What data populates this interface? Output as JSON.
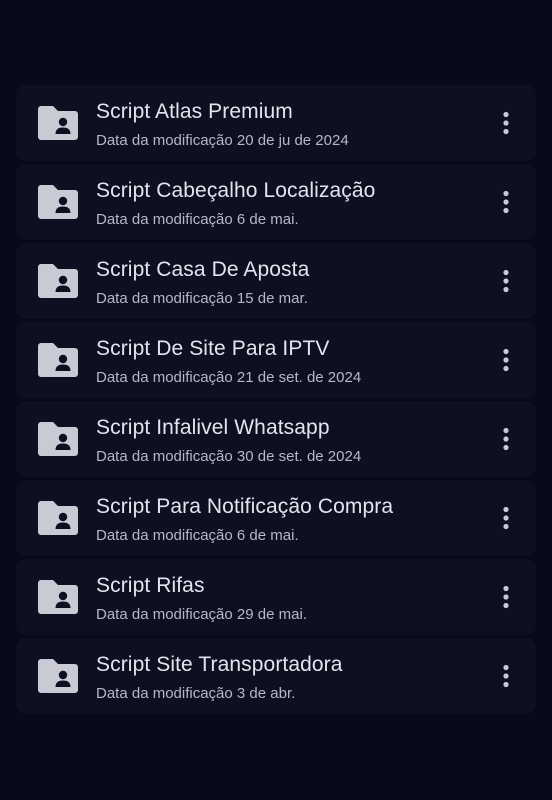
{
  "colors": {
    "background": "#080a1a",
    "card": "#0e1022",
    "title_text": "#e4e5ec",
    "meta_text": "#b6b8c4",
    "icon": "#c9cad4"
  },
  "icons": {
    "file": "shared-folder-icon",
    "menu": "more-vert-icon"
  },
  "files": [
    {
      "name": "Script Atlas Premium",
      "modified": "Data da modificação 20 de ju de 2024"
    },
    {
      "name": "Script Cabeçalho Localização",
      "modified": "Data da modificação 6 de mai."
    },
    {
      "name": "Script Casa De Aposta",
      "modified": "Data da modificação 15 de mar."
    },
    {
      "name": "Script De Site Para IPTV",
      "modified": "Data da modificação 21 de set. de 2024"
    },
    {
      "name": "Script Infalivel Whatsapp",
      "modified": "Data da modificação 30 de set. de 2024"
    },
    {
      "name": "Script Para Notificação Compra",
      "modified": "Data da modificação 6 de mai."
    },
    {
      "name": "Script Rifas",
      "modified": "Data da modificação 29 de mai."
    },
    {
      "name": "Script Site Transportadora",
      "modified": "Data da modificação 3 de abr."
    }
  ]
}
